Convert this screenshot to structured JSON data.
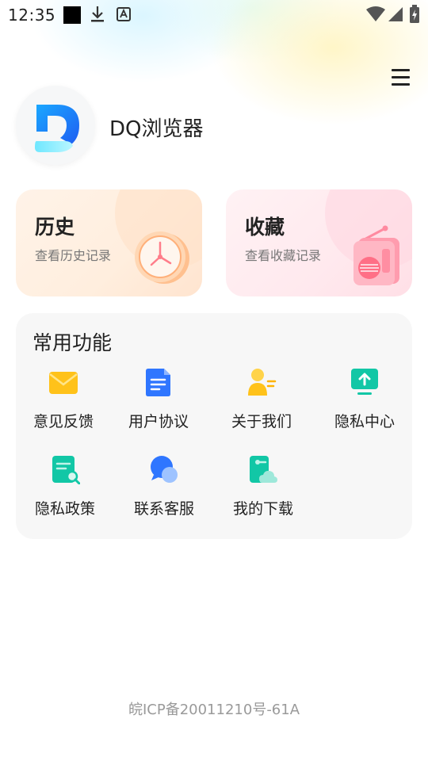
{
  "status_bar": {
    "time": "12:35"
  },
  "header": {
    "app_name": "DQ浏览器",
    "menu_icon": "menu-icon"
  },
  "cards": {
    "history": {
      "title": "历史",
      "subtitle": "查看历史记录",
      "icon": "clock-icon"
    },
    "favorites": {
      "title": "收藏",
      "subtitle": "查看收藏记录",
      "icon": "radio-icon"
    }
  },
  "functions": {
    "title": "常用功能",
    "items": [
      {
        "label": "意见反馈",
        "icon": "mail-icon"
      },
      {
        "label": "用户协议",
        "icon": "document-icon"
      },
      {
        "label": "关于我们",
        "icon": "user-card-icon"
      },
      {
        "label": "隐私中心",
        "icon": "upload-monitor-icon"
      },
      {
        "label": "隐私政策",
        "icon": "search-document-icon"
      },
      {
        "label": "联系客服",
        "icon": "chat-icon"
      },
      {
        "label": "我的下载",
        "icon": "cloud-download-icon"
      }
    ]
  },
  "footer": {
    "icp": "皖ICP备20011210号-61A"
  },
  "colors": {
    "accent_blue": "#1f6ff2",
    "accent_teal": "#12c7a6",
    "accent_yellow": "#ffc21a"
  }
}
